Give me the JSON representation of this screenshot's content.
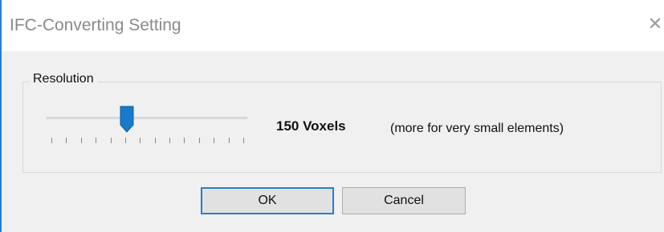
{
  "window": {
    "title": "IFC-Converting Setting",
    "close_symbol": "✕"
  },
  "resolution": {
    "group_label": "Resolution",
    "value_label": "150 Voxels",
    "hint": "(more for very small elements)",
    "slider_fraction": 0.4,
    "tick_count": 14
  },
  "buttons": {
    "ok_label": "OK",
    "cancel_label": "Cancel"
  },
  "colors": {
    "accent": "#2a7cd3",
    "thumb": "#1979ca"
  }
}
